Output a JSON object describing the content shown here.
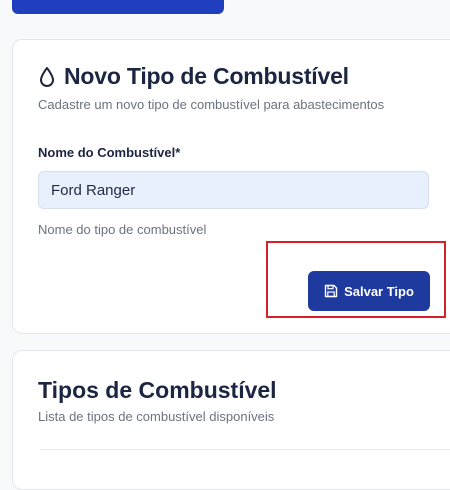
{
  "form_card": {
    "title": "Novo Tipo de Combustível",
    "subtitle": "Cadastre um novo tipo de combustível para abastecimentos",
    "field": {
      "label": "Nome do Combustível*",
      "value": "Ford Ranger",
      "help": "Nome do tipo de combustível"
    },
    "save_button_label": "Salvar Tipo"
  },
  "list_card": {
    "title": "Tipos de Combustível",
    "subtitle": "Lista de tipos de combustível disponíveis"
  },
  "icons": {
    "title_icon": "droplet-icon",
    "save_icon": "floppy-disk-icon"
  },
  "colors": {
    "primary": "#1f3a9e",
    "highlight": "#d6202b",
    "input_bg": "#e9f0fd"
  }
}
